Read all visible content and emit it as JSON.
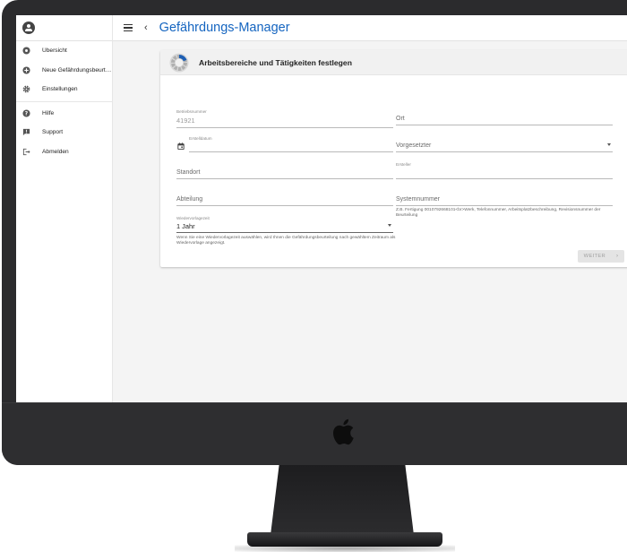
{
  "app": {
    "title": "Gefährdungs-Manager",
    "brand_mark": "U"
  },
  "sidebar": {
    "items": [
      {
        "label": "Übersicht",
        "icon": "overview-icon"
      },
      {
        "label": "Neue Gefährdungsbeurt…",
        "icon": "add-circle-icon"
      },
      {
        "label": "Einstellungen",
        "icon": "gear-icon"
      },
      {
        "label": "Hilfe",
        "icon": "help-icon"
      },
      {
        "label": "Support",
        "icon": "feedback-icon"
      },
      {
        "label": "Abmelden",
        "icon": "logout-icon"
      }
    ]
  },
  "card": {
    "title": "Arbeitsbereiche und Tätigkeiten festlegen",
    "fields": {
      "betriebsnummer": {
        "label": "Betriebsnummer",
        "value": "41921"
      },
      "ort": {
        "placeholder": "Ort"
      },
      "erstelldatum": {
        "label": "Erstelldatum",
        "value": ""
      },
      "vorgesetzter": {
        "placeholder": "Vorgesetzter"
      },
      "standort": {
        "placeholder": "Standort"
      },
      "ersteller": {
        "label": "Ersteller",
        "value": ""
      },
      "abteilung": {
        "placeholder": "Abteilung"
      },
      "systemnummer": {
        "placeholder": "Systemnummer",
        "hint": "Z.B. Fertigung 0010792668101<br>Werk, Telefonnummer, Arbeitsplatzbeschreibung, Revisionsnummer der Beurteilung"
      },
      "wiedervorlagezeit": {
        "label": "Wiedervorlagezeit",
        "value": "1 Jahr",
        "hint": "Wenn Sie eine Wiedervorlagezeit auswählen, wird Ihnen die Gefährdungsbeurteilung nach gewähltem Zeitraum als Wiedervorlage angezeigt."
      }
    },
    "next_button": "WEITER"
  },
  "colors": {
    "accent": "#1565c0",
    "bezel": "#2b2b2d",
    "screen_bg": "#f4f4f4"
  }
}
